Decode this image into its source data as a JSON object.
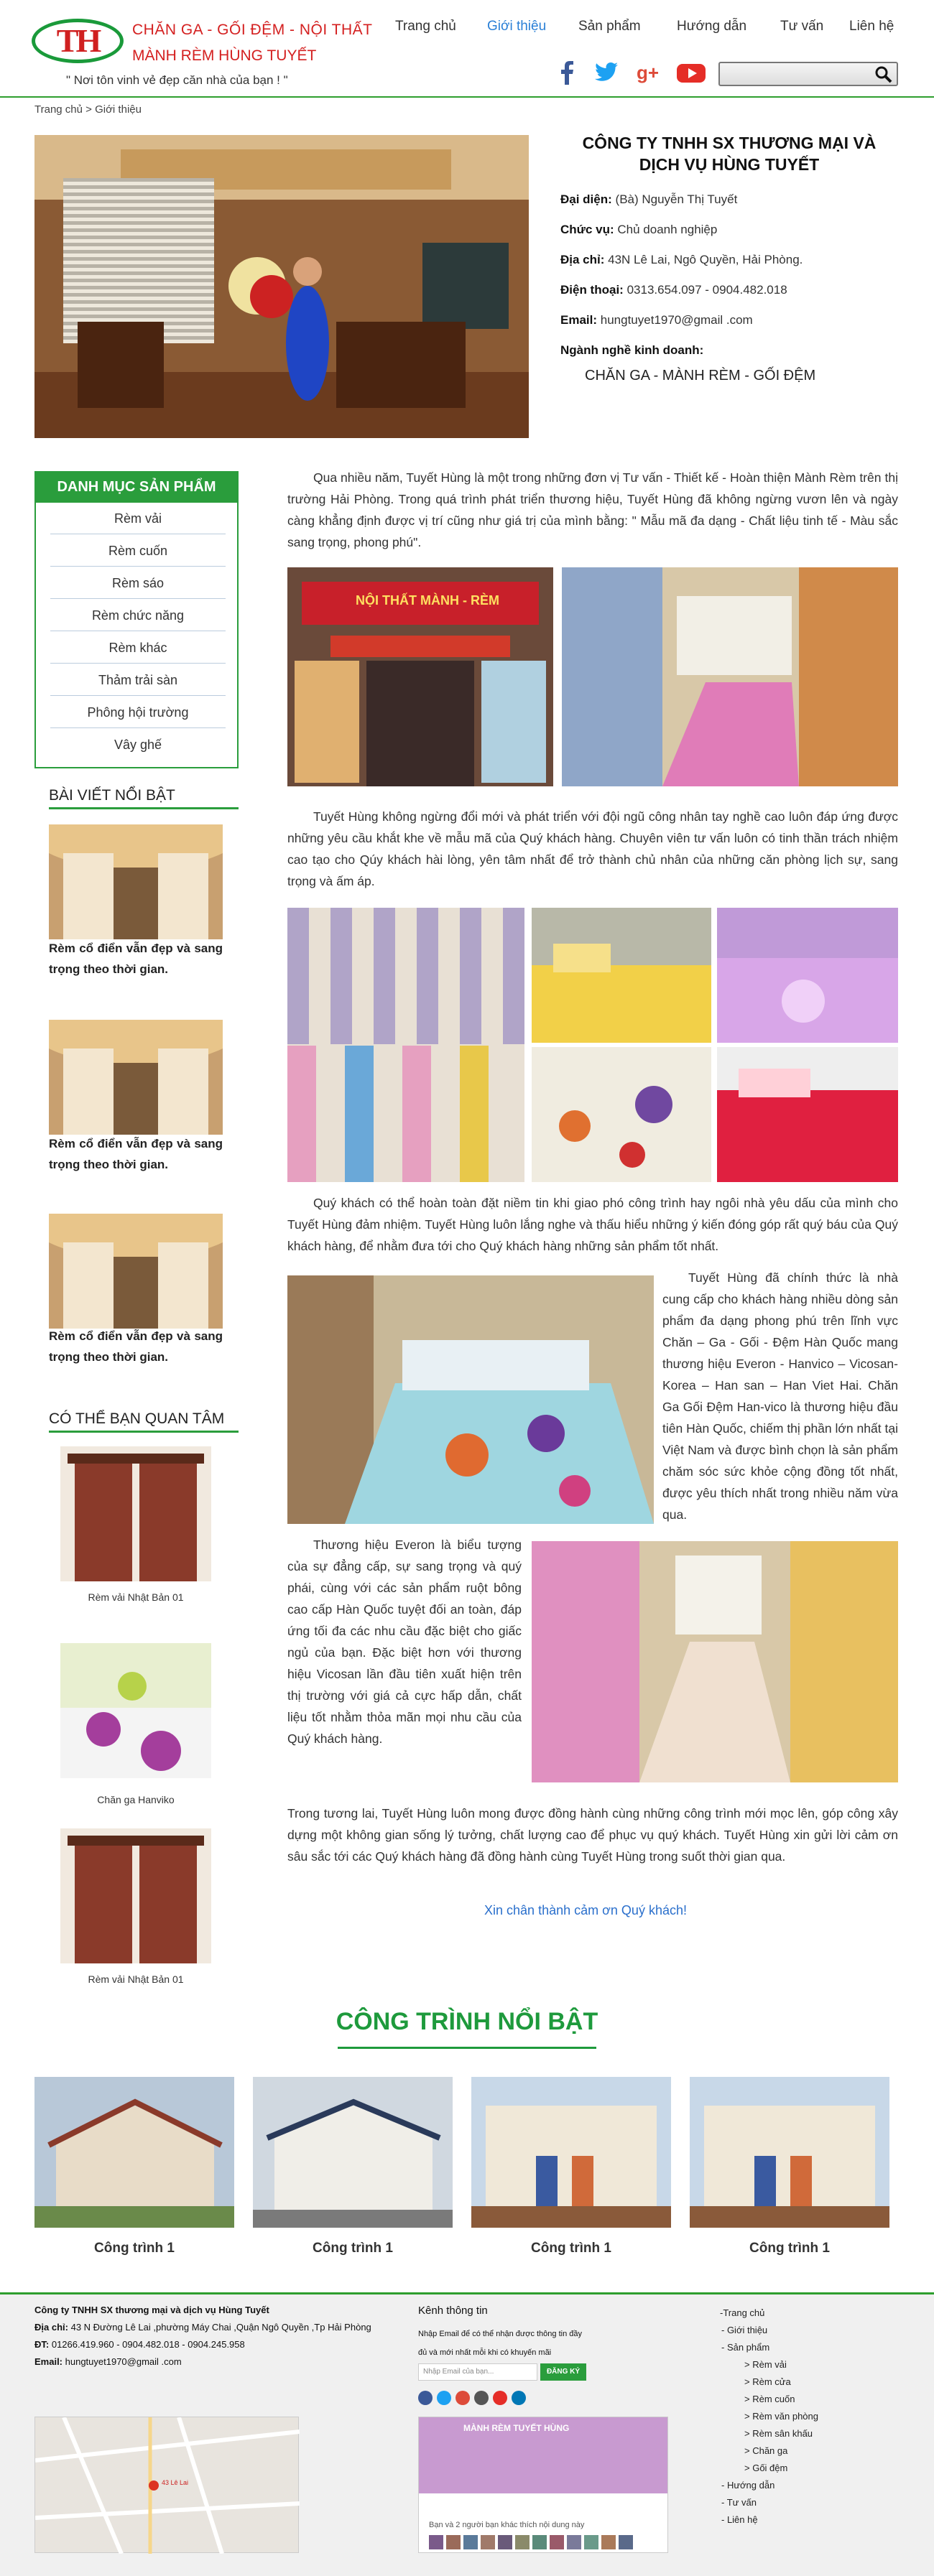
{
  "header": {
    "brand_line1": "CHĂN GA - GỐI ĐỆM - NỘI THẤT",
    "brand_line2": "MÀNH RÈM HÙNG TUYẾT",
    "slogan": "\" Nơi tôn vinh vẻ đẹp căn nhà của bạn ! \"",
    "nav": [
      "Trang chủ",
      "Giới thiệu",
      "Sản phẩm",
      "Hướng dẫn",
      "Tư vấn",
      "Liên hệ"
    ],
    "active_nav": "Giới thiệu",
    "search_placeholder": ""
  },
  "breadcrumb": {
    "home": "Trang chủ",
    "sep": ">",
    "current": "Giới thiệu"
  },
  "company": {
    "name_line1": "CÔNG TY TNHH SX THƯƠNG MẠI VÀ",
    "name_line2": "DỊCH VỤ HÙNG TUYẾT",
    "rep_label": "Đại diện:",
    "rep_value": "(Bà) Nguyễn Thị Tuyết",
    "role_label": "Chức vụ:",
    "role_value": "Chủ doanh nghiệp",
    "addr_label": "Địa chỉ:",
    "addr_value": "43N Lê Lai, Ngô Quyền, Hải Phòng.",
    "phone_label": "Điện thoại:",
    "phone_value": "0313.654.097 - 0904.482.018",
    "email_label": "Email:",
    "email_value": "hungtuyet1970@gmail .com",
    "business_label": "Ngành nghề kinh doanh:",
    "business_value": "CHĂN GA - MÀNH RÈM - GỐI ĐỆM"
  },
  "sidebar": {
    "category_title": "DANH MỤC SẢN PHẨM",
    "categories": [
      "Rèm vải",
      "Rèm cuốn",
      "Rèm sáo",
      "Rèm chức năng",
      "Rèm khác",
      "Thảm trải sàn",
      "Phông hội trường",
      "Vây ghế"
    ],
    "featured_title": "BÀI VIẾT NỔI BẬT",
    "featured_posts": [
      {
        "title": "Rèm cổ điển vẫn đẹp và sang trọng theo thời gian."
      },
      {
        "title": "Rèm cổ điển vẫn đẹp và sang trọng theo thời gian."
      },
      {
        "title": "Rèm cổ điển vẫn đẹp và sang trọng theo thời gian."
      }
    ],
    "care_title": "CÓ THỂ BẠN QUAN TÂM",
    "care_items": [
      {
        "title": "Rèm vải Nhật Bản 01"
      },
      {
        "title": "Chăn ga Hanviko"
      },
      {
        "title": "Rèm vải Nhật Bản 01"
      }
    ]
  },
  "content": {
    "p1": "Qua nhiều năm, Tuyết Hùng là một trong những đơn vị Tư vấn - Thiết kế - Hoàn thiện Mành Rèm trên thị trường Hải Phòng. Trong quá trình phát triển thương hiệu, Tuyết Hùng đã không ngừng vươn lên và ngày càng khẳng định được vị trí cũng như giá trị của mình bằng: \" Mẫu mã đa dạng - Chất liệu tinh tế - Màu sắc sang trọng, phong phú\".",
    "shop_sign": "NỘI THẤT MÀNH - RÈM",
    "p2": "Tuyết Hùng không ngừng đổi mới và phát triển với đội ngũ công nhân tay nghề cao luôn đáp ứng được những yêu cầu khắt khe về mẫu mã của Quý khách hàng. Chuyên viên tư vấn luôn có tinh thần trách nhiệm cao tạo cho Qúy khách hài lòng, yên tâm nhất để trở thành chủ nhân của những căn phòng lịch sự, sang trọng và ấm áp.",
    "p3": "Quý khách có thể hoàn toàn đặt niềm tin khi giao phó công trình hay ngôi nhà yêu dấu của mình cho Tuyết Hùng đảm nhiệm. Tuyết Hùng luôn lắng nghe và thấu hiểu những ý kiến đóng góp rất quý báu của Quý khách hàng, để nhằm đưa tới cho Quý khách hàng những sản phẩm tốt nhất.",
    "p4": "Tuyết Hùng đã chính thức là nhà cung cấp cho khách hàng nhiều dòng sản phẩm đa dạng phong phú trên lĩnh vực Chăn – Ga - Gối - Đệm Hàn Quốc mang thương hiệu Everon - Hanvico – Vicosan- Korea – Han san – Han Viet Hai. Chăn Ga Gối Đệm Han-vico là thương hiệu đầu tiên Hàn Quốc, chiếm thị phần lớn nhất tại Việt Nam và được bình chọn là sản phẩm chăm sóc sức khỏe cộng đồng tốt nhất, được yêu thích nhất trong nhiều năm vừa qua.",
    "p5": "Thương hiệu Everon là biểu tượng của sự đẳng cấp, sự sang trọng và quý phái, cùng với các sản phẩm ruột bông cao cấp Hàn Quốc tuyệt đối an toàn, đáp ứng tối đa các nhu cầu đặc biệt cho giấc ngủ của bạn. Đặc biệt hơn với thương hiệu Vicosan lần đầu tiên xuất hiện trên thị trường với giá cả cực hấp dẫn, chất liệu tốt nhằm thỏa mãn mọi nhu cầu của Quý khách hàng.",
    "p6": "Trong tương lai, Tuyết Hùng luôn mong được đồng hành cùng những công trình mới mọc lên, góp công xây dựng một không gian sống lý tưởng, chất lượng cao để phục vụ quý khách. Tuyết Hùng xin gửi lời cảm ơn sâu sắc tới các Quý khách hàng đã đồng hành cùng Tuyết Hùng trong suốt thời gian qua.",
    "thanks": "Xin chân thành cảm ơn Quý khách!"
  },
  "projects": {
    "title": "CÔNG TRÌNH NỔI BẬT",
    "items": [
      {
        "title": "Công trình 1"
      },
      {
        "title": "Công trình 1"
      },
      {
        "title": "Công trình 1"
      },
      {
        "title": "Công trình 1"
      }
    ]
  },
  "footer": {
    "company": "Công ty TNHH SX thương mại và dịch vụ Hùng Tuyết",
    "addr_label": "Địa chỉ:",
    "addr_value": "43 N Đường Lê Lai ,phường Máy Chai ,Quận Ngô Quyền ,Tp Hải Phòng",
    "phone_label": "ĐT:",
    "phone_value": "01266.419.960 - 0904.482.018 - 0904.245.958",
    "email_label": "Email:",
    "email_value": "hungtuyet1970@gmail .com",
    "map_label": "43 Lê Lai",
    "channel_title": "Kênh thông tin",
    "channel_desc": "Nhập Email để có thể nhận được thông tin đầy đủ và mới nhất mỗi khi có khuyến mãi",
    "email_placeholder": "Nhập Email của bạn...",
    "subscribe": "ĐĂNG KÝ",
    "fb_page": "MÀNH RÈM TUYẾT HÙNG",
    "fb_likes": "Bạn và 2 người bạn khác thích nội dung này",
    "links": [
      "-Trang chủ",
      "- Giới thiệu",
      "- Sản phẩm",
      "> Rèm vải",
      "> Rèm cửa",
      "> Rèm cuốn",
      "> Rèm văn phòng",
      "> Rèm sân khấu",
      "> Chăn ga",
      "> Gối đệm",
      "- Hướng dẫn",
      "- Tư vấn",
      "- Liên hệ"
    ]
  },
  "colors": {
    "green": "#2a9d3c",
    "red": "#d42020",
    "blue": "#2a7fd6"
  },
  "icons": [
    "facebook-icon",
    "twitter-icon",
    "google-plus-icon",
    "youtube-icon",
    "search-icon"
  ]
}
